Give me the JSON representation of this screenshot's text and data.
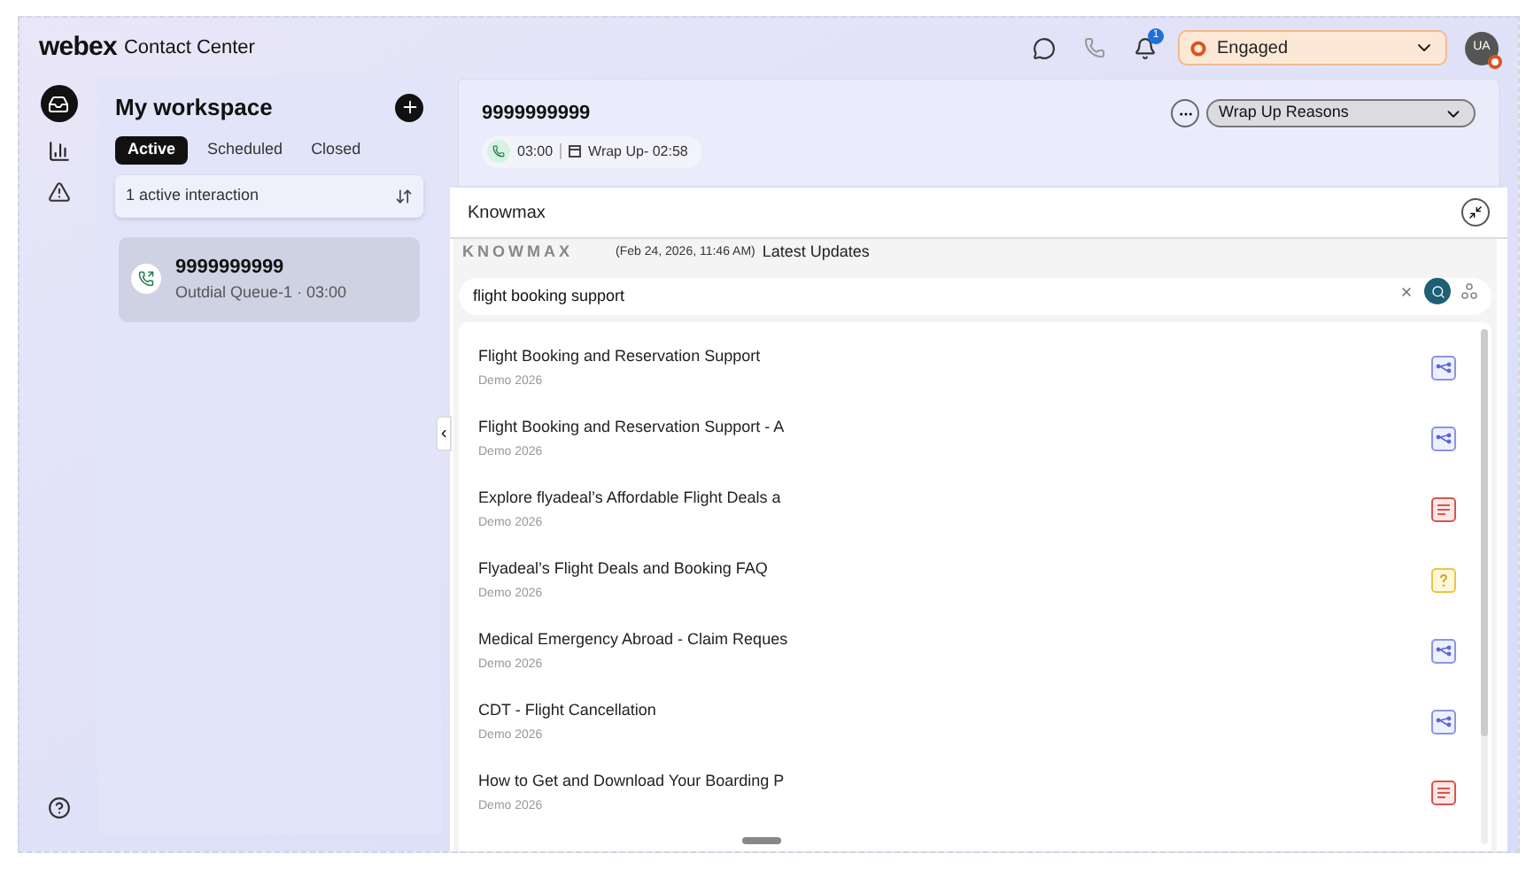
{
  "header": {
    "logo": "webex",
    "product": "Contact Center",
    "notification_count": "1",
    "status": "Engaged",
    "avatar": "UA"
  },
  "workspace": {
    "title": "My workspace",
    "tabs": [
      {
        "label": "Active",
        "selected": true
      },
      {
        "label": "Scheduled",
        "selected": false
      },
      {
        "label": "Closed",
        "selected": false
      }
    ],
    "summary": "1 active interaction",
    "interactions": [
      {
        "number": "9999999999",
        "detail": "Outdial Queue-1 · 03:00",
        "selected": true
      }
    ]
  },
  "call": {
    "number": "9999999999",
    "duration": "03:00",
    "wrap_up": "Wrap Up- 02:58",
    "wrap_up_select": "Wrap Up Reasons"
  },
  "knowmax": {
    "title": "Knowmax",
    "brand": "KNOWMAX",
    "timestamp": "(Feb 24, 2026, 11:46 AM)",
    "updates": "Latest Updates",
    "search_value": "flight booking support",
    "results": [
      {
        "title": "Flight Booking and Reservation Support",
        "source": "Demo 2026",
        "kind": "flow"
      },
      {
        "title": "Flight Booking and Reservation Support - A",
        "source": "Demo 2026",
        "kind": "flow"
      },
      {
        "title": "Explore flyadeal’s Affordable Flight Deals a",
        "source": "Demo 2026",
        "kind": "article"
      },
      {
        "title": "Flyadeal’s Flight Deals and Booking FAQ",
        "source": "Demo 2026",
        "kind": "faq"
      },
      {
        "title": "Medical Emergency Abroad - Claim Reques",
        "source": "Demo 2026",
        "kind": "flow"
      },
      {
        "title": "CDT - Flight Cancellation",
        "source": "Demo 2026",
        "kind": "flow"
      },
      {
        "title": "How to Get and Download Your Boarding P",
        "source": "Demo 2026",
        "kind": "article"
      }
    ]
  }
}
